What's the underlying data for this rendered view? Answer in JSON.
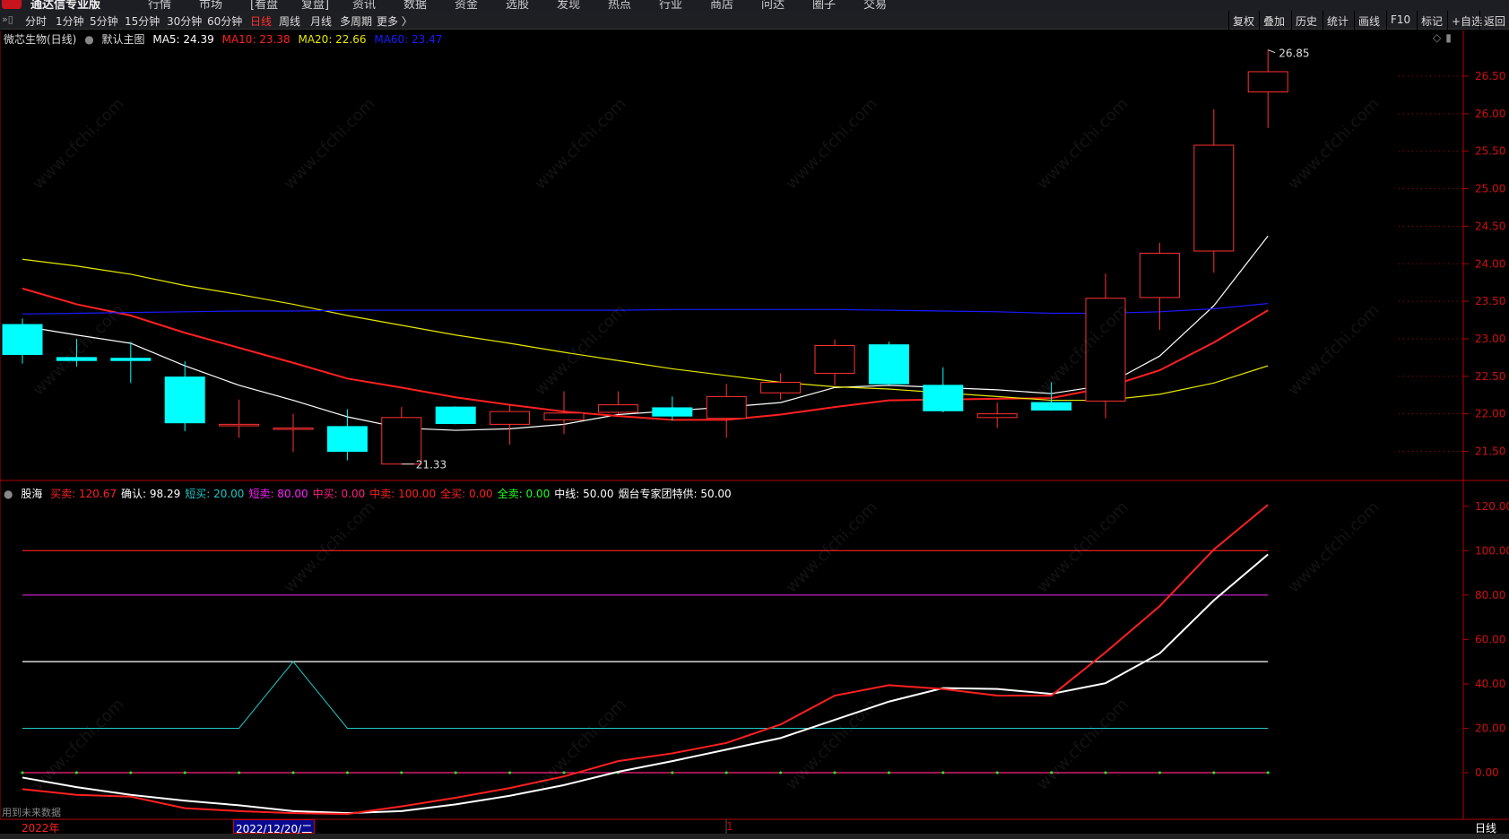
{
  "menubar": {
    "app_title": "通达信专业版",
    "items": [
      "行情",
      "市场",
      "[看盘",
      "复盘]",
      "资讯",
      "数据",
      "资金",
      "选股",
      "发现",
      "热点",
      "行业",
      "商店",
      "问达",
      "圈子",
      "交易"
    ]
  },
  "toolbar": {
    "periods": [
      "分时",
      "1分钟",
      "5分钟",
      "15分钟",
      "30分钟",
      "60分钟",
      "日线",
      "周线",
      "月线",
      "多周期",
      "更多 〉"
    ],
    "active_period": "日线",
    "right_buttons": [
      "复权",
      "叠加",
      "历史",
      "统计",
      "画线",
      "F10",
      "标记",
      "+自选",
      "返回"
    ]
  },
  "main_header": {
    "stock": "微芯生物(日线)",
    "template": "默认主图",
    "ma5": "MA5: 24.39",
    "ma10": "MA10: 23.38",
    "ma20": "MA20: 22.66",
    "ma60": "MA60: 23.47"
  },
  "indicator_header": {
    "name": "股海",
    "items": [
      {
        "label": "买卖: 120.67",
        "color": "#ff2020"
      },
      {
        "label": "确认: 98.29",
        "color": "#ffffff"
      },
      {
        "label": "短买: 20.00",
        "color": "#20c8c8"
      },
      {
        "label": "短卖: 80.00",
        "color": "#ff20ff"
      },
      {
        "label": "中买: 0.00",
        "color": "#ff2080"
      },
      {
        "label": "中卖: 100.00",
        "color": "#ff2020"
      },
      {
        "label": "全买: 0.00",
        "color": "#ff2020"
      },
      {
        "label": "全卖: 0.00",
        "color": "#20ff20"
      },
      {
        "label": "中线: 50.00",
        "color": "#ffffff"
      },
      {
        "label": "烟台专家团特供: 50.00",
        "color": "#ffffff"
      }
    ]
  },
  "notes": {
    "future_data": "用到未来数据"
  },
  "date_bar": {
    "year": "2022年",
    "cursor_date": "2022/12/20/二",
    "mark": "1",
    "period": "日线"
  },
  "colors": {
    "up": "#ff3232",
    "down": "#00ffff",
    "axis": "#b00000",
    "ma5": "#ffffff",
    "ma10": "#ff2020",
    "ma20": "#e8e800",
    "ma60": "#1a1aff"
  },
  "chart_data": [
    {
      "type": "candlestick",
      "title": "微芯生物(日线)",
      "ylim": [
        21.2,
        27.0
      ],
      "yticks": [
        "26.50",
        "26.00",
        "25.50",
        "25.00",
        "24.50",
        "24.00",
        "23.50",
        "23.00",
        "22.50",
        "22.00",
        "21.50"
      ],
      "high_label": "26.85",
      "low_label": "21.33",
      "candles": [
        [
          23.19,
          22.79,
          23.27,
          22.67
        ],
        [
          22.75,
          22.71,
          23.0,
          22.63
        ],
        [
          22.74,
          22.71,
          22.96,
          22.41
        ],
        [
          22.49,
          21.88,
          22.7,
          21.77
        ],
        [
          21.84,
          21.86,
          22.19,
          21.68
        ],
        [
          21.8,
          21.81,
          22.0,
          21.49
        ],
        [
          21.83,
          21.5,
          22.06,
          21.38
        ],
        [
          21.33,
          21.95,
          22.09,
          21.33
        ],
        [
          22.09,
          21.87,
          22.1,
          21.86
        ],
        [
          21.86,
          22.03,
          22.13,
          21.59
        ],
        [
          21.92,
          22.01,
          22.3,
          21.73
        ],
        [
          22.02,
          22.12,
          22.3,
          22.0
        ],
        [
          22.08,
          21.97,
          22.23,
          21.91
        ],
        [
          21.94,
          22.23,
          22.4,
          21.68
        ],
        [
          22.28,
          22.42,
          22.54,
          22.19
        ],
        [
          22.54,
          22.91,
          22.99,
          22.38
        ],
        [
          22.92,
          22.4,
          22.96,
          22.38
        ],
        [
          22.38,
          22.04,
          22.62,
          22.02
        ],
        [
          21.95,
          22.0,
          22.15,
          21.81
        ],
        [
          22.15,
          22.05,
          22.42,
          22.04
        ],
        [
          22.17,
          23.54,
          23.87,
          21.94
        ],
        [
          23.55,
          24.14,
          24.28,
          23.12
        ],
        [
          24.17,
          25.58,
          26.06,
          23.88
        ],
        [
          26.29,
          26.56,
          26.85,
          25.81
        ]
      ],
      "series": [
        {
          "name": "MA5",
          "color": "#ffffff",
          "values": [
            23.17,
            23.05,
            22.94,
            22.64,
            22.38,
            22.18,
            21.96,
            21.81,
            21.78,
            21.8,
            21.86,
            21.99,
            22.04,
            22.09,
            22.15,
            22.35,
            22.38,
            22.35,
            22.32,
            22.27,
            22.38,
            22.77,
            23.44,
            24.37
          ]
        },
        {
          "name": "MA10",
          "color": "#ff2020",
          "values": [
            23.67,
            23.46,
            23.31,
            23.08,
            22.88,
            22.68,
            22.47,
            22.35,
            22.22,
            22.12,
            22.03,
            21.97,
            21.92,
            21.92,
            21.99,
            22.09,
            22.18,
            22.19,
            22.2,
            22.21,
            22.35,
            22.58,
            22.95,
            23.38
          ]
        },
        {
          "name": "MA20",
          "color": "#e8e800",
          "values": [
            24.06,
            23.97,
            23.86,
            23.71,
            23.59,
            23.46,
            23.31,
            23.18,
            23.05,
            22.94,
            22.82,
            22.71,
            22.6,
            22.51,
            22.42,
            22.36,
            22.33,
            22.28,
            22.23,
            22.18,
            22.18,
            22.26,
            22.41,
            22.64
          ]
        },
        {
          "name": "MA60",
          "color": "#1a1aff",
          "values": [
            23.33,
            23.34,
            23.35,
            23.36,
            23.37,
            23.37,
            23.38,
            23.38,
            23.38,
            23.38,
            23.38,
            23.38,
            23.39,
            23.39,
            23.39,
            23.39,
            23.38,
            23.37,
            23.36,
            23.34,
            23.34,
            23.36,
            23.4,
            23.47
          ]
        }
      ]
    },
    {
      "type": "line",
      "title": "股海",
      "ylim": [
        -22,
        125
      ],
      "yticks": [
        "120.00",
        "100.00",
        "80.00",
        "60.00",
        "40.00",
        "20.00",
        "0.00"
      ],
      "hlines": [
        {
          "value": 100,
          "color": "#ff2020"
        },
        {
          "value": 80,
          "color": "#c020c0"
        },
        {
          "value": 50,
          "color": "#ffffff"
        },
        {
          "value": 0,
          "color": "#ff2080"
        }
      ],
      "series": [
        {
          "name": "买卖",
          "color": "#ff2020",
          "values": [
            -7.4,
            -10,
            -10.8,
            -16,
            -17.3,
            -18.2,
            -18.6,
            -15.2,
            -11.3,
            -6.9,
            -1.7,
            5.2,
            8.7,
            13.4,
            21.7,
            34.7,
            39.4,
            37.7,
            34.7,
            34.7,
            54.2,
            75,
            100.5,
            120.67
          ]
        },
        {
          "name": "确认",
          "color": "#ffffff",
          "values": [
            -2.2,
            -6.5,
            -10,
            -12.6,
            -14.7,
            -17.3,
            -18.2,
            -17.3,
            -14.3,
            -10.4,
            -5.6,
            0.4,
            5.2,
            10.4,
            15.6,
            23.8,
            32,
            38.1,
            37.7,
            35.5,
            40.3,
            53.7,
            77.6,
            98.29
          ]
        },
        {
          "name": "短买",
          "color": "#20c8c8",
          "values": [
            20,
            20,
            20,
            20,
            20,
            50,
            20,
            20,
            20,
            20,
            20,
            20,
            20,
            20,
            20,
            20,
            20,
            20,
            20,
            20,
            20,
            20,
            20,
            20
          ]
        }
      ]
    }
  ]
}
